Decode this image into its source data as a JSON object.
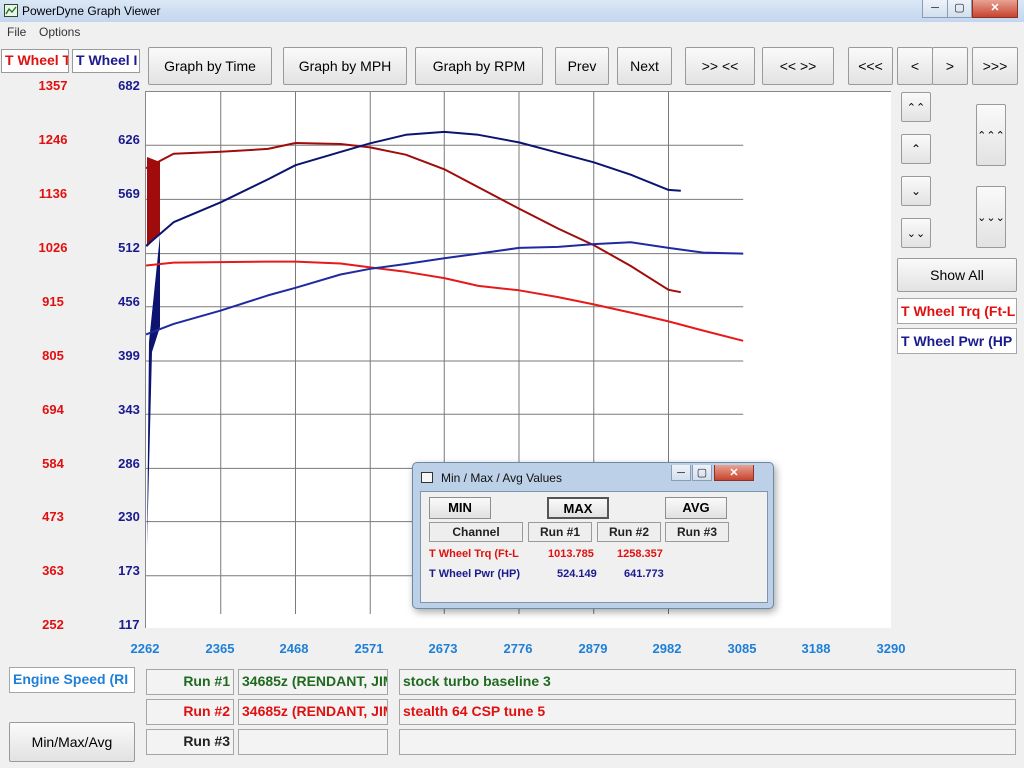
{
  "window": {
    "title": "PowerDyne Graph Viewer",
    "min_label": "─",
    "max_label": "▢",
    "close_label": "✕"
  },
  "menu": {
    "file": "File",
    "options": "Options"
  },
  "channel_tabs": {
    "torque": "T Wheel T",
    "power": "T Wheel I"
  },
  "toolbar": {
    "by_time": "Graph by Time",
    "by_mph": "Graph by MPH",
    "by_rpm": "Graph by RPM",
    "prev": "Prev",
    "next": "Next",
    "zoom_in": ">> <<",
    "zoom_out": "<< >>",
    "far_left": "<<<",
    "left": "<",
    "right": ">",
    "far_right": ">>>"
  },
  "y_axis_torque": [
    "1357",
    "1246",
    "1136",
    "1026",
    "915",
    "805",
    "694",
    "584",
    "473",
    "363",
    "252"
  ],
  "y_axis_power": [
    "682",
    "626",
    "569",
    "512",
    "456",
    "399",
    "343",
    "286",
    "230",
    "173",
    "117"
  ],
  "x_axis": [
    "2262",
    "2365",
    "2468",
    "2571",
    "2673",
    "2776",
    "2879",
    "2982",
    "3085",
    "3188",
    "3290"
  ],
  "right_panel": {
    "scroll_up_fast": "⌃⌃",
    "scroll_up_fastest": "⌃⌃⌃",
    "scroll_up": "⌃",
    "scroll_down": "⌄",
    "scroll_down_fast": "⌄⌄",
    "scroll_down_fastest": "⌄⌄⌄",
    "show_all": "Show All",
    "legend_torque": "T Wheel Trq (Ft-L",
    "legend_power": "T Wheel Pwr (HP"
  },
  "bottom": {
    "x_channel": "Engine Speed (RI",
    "minmax_button": "Min/Max/Avg",
    "runs": [
      {
        "label": "Run #1",
        "file": "34685z (RENDANT, JIM",
        "desc": "stock turbo baseline 3"
      },
      {
        "label": "Run #2",
        "file": "34685z (RENDANT, JIM",
        "desc": "stealth 64 CSP tune 5"
      },
      {
        "label": "Run #3",
        "file": "",
        "desc": ""
      }
    ]
  },
  "dialog": {
    "title": "Min / Max / Avg Values",
    "min_label": "MIN",
    "max_label": "MAX",
    "avg_label": "AVG",
    "headers": [
      "Channel",
      "Run #1",
      "Run #2",
      "Run #3"
    ],
    "rows": [
      {
        "channel": "T Wheel Trq (Ft-L",
        "run1": "1013.785",
        "run2": "1258.357",
        "run3": ""
      },
      {
        "channel": "T Wheel Pwr (HP)",
        "run1": "524.149",
        "run2": "641.773",
        "run3": ""
      }
    ]
  },
  "colors": {
    "torque": "#e01010",
    "power": "#1a1a8e",
    "run1_torque": "#e61a1a",
    "run2_torque": "#a00c0c",
    "run1_power": "#1f2aa0",
    "run2_power": "#0d1470",
    "x_axis": "#1e7fd8"
  },
  "chart_data": {
    "type": "line",
    "x_label": "Engine Speed (RI",
    "xlim": [
      2262,
      3290
    ],
    "ylim_torque": [
      252,
      1357
    ],
    "ylim_power": [
      117,
      682
    ],
    "grid": true,
    "series": [
      {
        "name": "T Wheel Trq (Ft-L) Run #1",
        "axis": "torque",
        "x": [
          2262,
          2300,
          2365,
          2430,
          2468,
          2530,
          2571,
          2620,
          2673,
          2720,
          2776,
          2830,
          2879,
          2930,
          2982,
          3030,
          3085
        ],
        "y": [
          1000,
          1006,
          1007,
          1008,
          1008,
          1004,
          996,
          987,
          974,
          958,
          949,
          935,
          920,
          903,
          885,
          866,
          845
        ]
      },
      {
        "name": "T Wheel Trq (Ft-L) Run #2",
        "axis": "torque",
        "x": [
          2262,
          2300,
          2365,
          2430,
          2468,
          2530,
          2571,
          2620,
          2673,
          2720,
          2776,
          2830,
          2879,
          2930,
          2982,
          2999
        ],
        "y": [
          1200,
          1230,
          1234,
          1240,
          1252,
          1250,
          1243,
          1228,
          1198,
          1161,
          1117,
          1076,
          1042,
          999,
          950,
          945
        ]
      },
      {
        "name": "T Wheel Pwr (HP) Run #1",
        "axis": "power",
        "x": [
          2262,
          2300,
          2365,
          2430,
          2468,
          2530,
          2571,
          2620,
          2673,
          2720,
          2776,
          2830,
          2879,
          2930,
          2982,
          3030,
          3085
        ],
        "y": [
          427,
          438,
          452,
          468,
          476,
          490,
          496,
          501,
          507,
          512,
          518,
          519,
          522,
          524,
          518,
          513,
          512
        ]
      },
      {
        "name": "T Wheel Pwr (HP) Run #2",
        "axis": "power",
        "x": [
          2262,
          2300,
          2365,
          2430,
          2468,
          2530,
          2571,
          2620,
          2673,
          2720,
          2776,
          2830,
          2879,
          2930,
          2982,
          2999
        ],
        "y": [
          520,
          545,
          566,
          590,
          605,
          619,
          628,
          637,
          640,
          637,
          629,
          618,
          608,
          595,
          579,
          578
        ]
      }
    ]
  }
}
